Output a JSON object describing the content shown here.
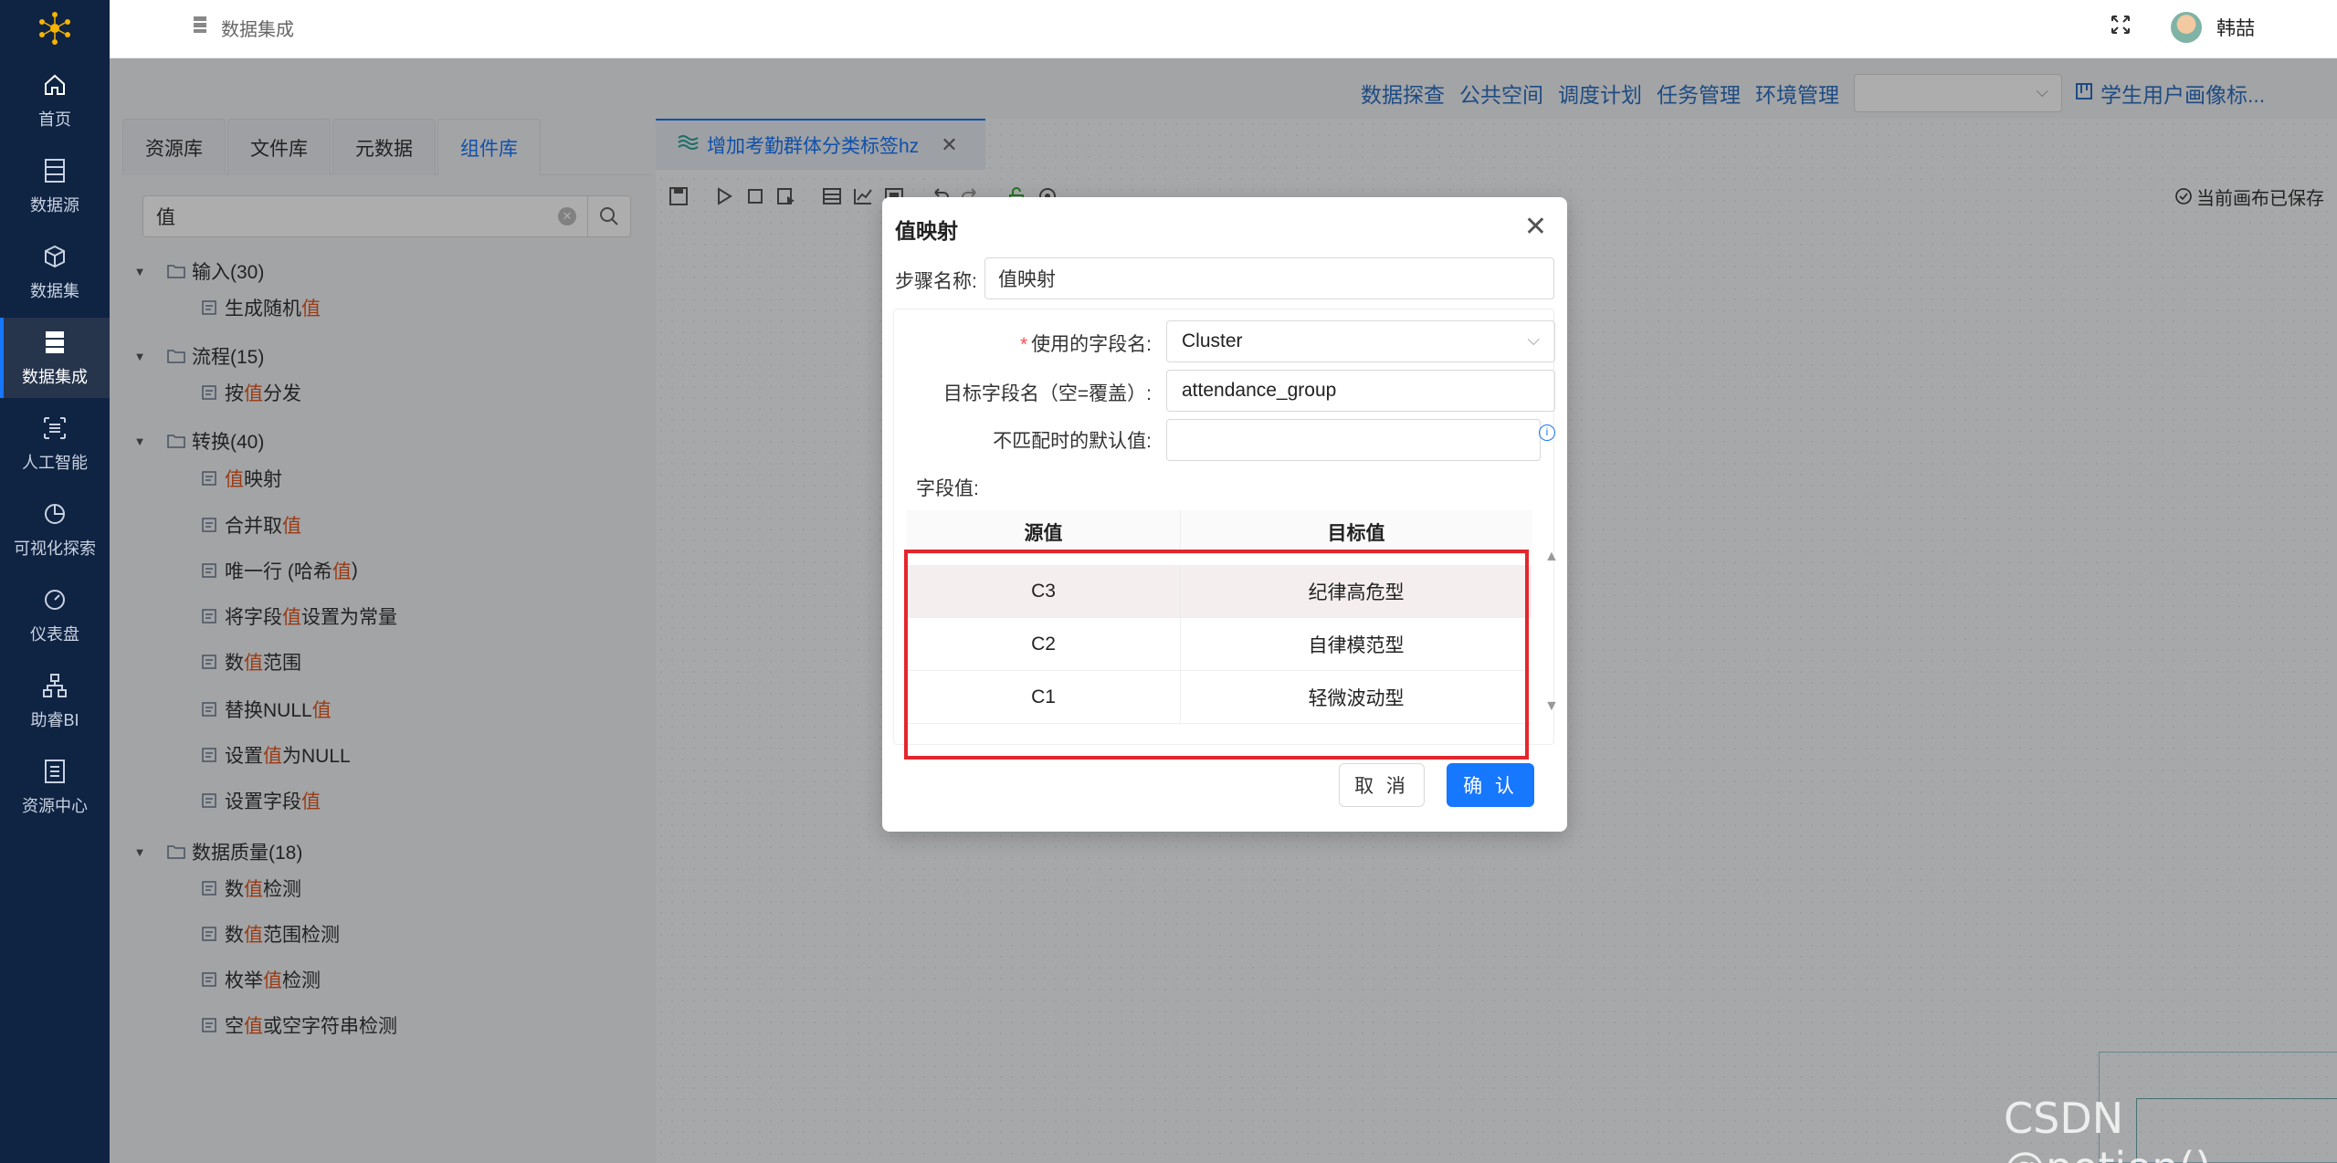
{
  "header": {
    "title": "数据集成",
    "user": "韩喆"
  },
  "sidenav": [
    {
      "label": "首页",
      "icon": "home-icon"
    },
    {
      "label": "数据源",
      "icon": "datasource-icon"
    },
    {
      "label": "数据集",
      "icon": "cube-icon"
    },
    {
      "label": "数据集成",
      "icon": "server-icon"
    },
    {
      "label": "人工智能",
      "icon": "ai-icon"
    },
    {
      "label": "可视化探索",
      "icon": "pie-chart-icon"
    },
    {
      "label": "仪表盘",
      "icon": "dashboard-icon"
    },
    {
      "label": "助睿BI",
      "icon": "org-chart-icon"
    },
    {
      "label": "资源中心",
      "icon": "resource-icon"
    }
  ],
  "toplinks": [
    "数据探查",
    "公共空间",
    "调度计划",
    "任务管理",
    "环境管理"
  ],
  "project_link": "学生用户画像标...",
  "leftpanel": {
    "tabs": [
      "资源库",
      "文件库",
      "元数据",
      "组件库"
    ],
    "search_value": "值",
    "tree": [
      {
        "type": "group",
        "label": "输入(30)"
      },
      {
        "type": "item",
        "pre": "生成随机",
        "hl": "值",
        "post": ""
      },
      {
        "type": "group",
        "label": "流程(15)"
      },
      {
        "type": "item",
        "pre": "按 ",
        "hl": "值",
        "post": " 分发"
      },
      {
        "type": "group",
        "label": "转换(40)"
      },
      {
        "type": "item",
        "pre": "",
        "hl": "值",
        "post": " 映射"
      },
      {
        "type": "item",
        "pre": "合并取 ",
        "hl": "值",
        "post": ""
      },
      {
        "type": "item",
        "pre": "唯一行 (哈希 ",
        "hl": "值",
        "post": " )"
      },
      {
        "type": "item",
        "pre": "将字段 ",
        "hl": "值",
        "post": " 设置为常量"
      },
      {
        "type": "item",
        "pre": "数 ",
        "hl": "值",
        "post": " 范围"
      },
      {
        "type": "item",
        "pre": "替换NULL ",
        "hl": "值",
        "post": ""
      },
      {
        "type": "item",
        "pre": "设置 ",
        "hl": "值",
        "post": " 为NULL"
      },
      {
        "type": "item",
        "pre": "设置字段 ",
        "hl": "值",
        "post": ""
      },
      {
        "type": "group",
        "label": "数据质量(18)"
      },
      {
        "type": "item",
        "pre": "数 ",
        "hl": "值",
        "post": " 检测"
      },
      {
        "type": "item",
        "pre": "数 ",
        "hl": "值",
        "post": " 范围检测"
      },
      {
        "type": "item",
        "pre": "枚举 ",
        "hl": "值",
        "post": " 检测"
      },
      {
        "type": "item",
        "pre": "空 ",
        "hl": "值",
        "post": " 或空字符串检测"
      }
    ]
  },
  "canvas": {
    "tab_title": "增加考勤群体分类标签hz",
    "saved_status": "当前画布已保存"
  },
  "modal": {
    "title": "值映射",
    "step_label": "步骤名称:",
    "step_value": "值映射",
    "field_label": "使用的字段名:",
    "field_value": "Cluster",
    "target_label": "目标字段名（空=覆盖）:",
    "target_value": "attendance_group",
    "default_label": "不匹配时的默认值:",
    "default_value": "",
    "values_label": "字段值:",
    "columns": [
      "源值",
      "目标值"
    ],
    "rows": [
      {
        "source": "C3",
        "target": "纪律高危型"
      },
      {
        "source": "C2",
        "target": "自律模范型"
      },
      {
        "source": "C1",
        "target": "轻微波动型"
      }
    ],
    "cancel_label": "取 消",
    "ok_label": "确 认"
  },
  "watermark": "CSDN @potion()",
  "colors": {
    "nav_bg": "#0f2343",
    "primary": "#1677ff",
    "highlight": "#e4571d",
    "annotation": "#e3262d"
  }
}
